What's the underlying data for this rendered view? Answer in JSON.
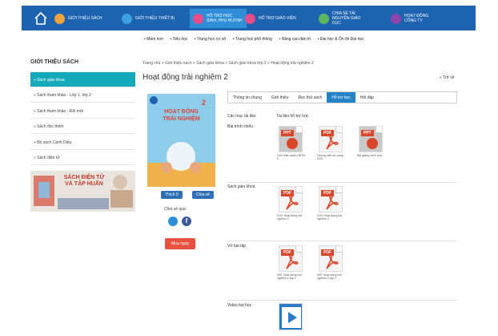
{
  "topnav": {
    "items": [
      {
        "label": "GIỚI THIỆU SÁCH",
        "icon": "book-icon",
        "color": "#f0a23b"
      },
      {
        "label": "GIỚI THIỆU THIẾT BỊ",
        "icon": "device-icon",
        "color": "#3aa0e0"
      },
      {
        "label": "HỖ TRỢ HỌC SINH, PHỤ HUYNH",
        "icon": "student-icon",
        "color": "#e94e8a"
      },
      {
        "label": "HỖ TRỢ GIÁO VIÊN",
        "icon": "teacher-icon",
        "color": "#e94e8a"
      },
      {
        "label": "CHIA SẺ TÀI NGUYÊN GIÁO DỤC",
        "icon": "share-icon",
        "color": "#5cb85c"
      },
      {
        "label": "HOẠT ĐỘNG CÔNG TY",
        "icon": "company-icon",
        "color": "#8e44ad"
      }
    ]
  },
  "subnav": {
    "items": [
      "• Mầm non",
      "• Tiểu học",
      "• Trung học cơ sở",
      "• Trung học phổ thông",
      "• Nâng cao dân trí",
      "• Đại học & Ôn thi Đại học"
    ]
  },
  "sidebar": {
    "title": "GIỚI THIỆU SÁCH",
    "items": [
      "» Sách giáo khoa",
      "» Sách tham khảo - Lớp 1, lớp 2",
      "» Sách tham khảo - Đổi mới",
      "» Sách đọc thêm",
      "» Bộ sách Cánh Diều",
      "» Sách điện tử"
    ],
    "banner": "SÁCH ĐIỆN TỬ VÀ TẬP HUẤN"
  },
  "main": {
    "breadcrumb": "Trang chủ > Giới thiệu sách > Sách giáo khoa > Sách giáo khoa lớp 2 > Hoạt động trải nghiệm 2",
    "title": "Hoạt động trải nghiệm 2",
    "back_label": "« Trở về",
    "book_cover": {
      "line1": "HOẠT ĐỘNG",
      "line2": "TRẢI NGHIỆM",
      "number": "2"
    },
    "like_label": "Thích 0",
    "share_label": "Chia sẻ",
    "share_via": "Chia sẻ qua:",
    "buy_label": "Mua ngay",
    "tabs": [
      "Thông tin chung",
      "Giới thiệu",
      "Đọc thử sách",
      "Hỗ trợ học",
      "Hỏi đáp"
    ],
    "active_tab": 3,
    "head_col1": "Các mục tài liệu",
    "head_col2": "Tài liệu hỗ trợ học",
    "sections": [
      {
        "label": "Bài trình chiếu",
        "files": [
          {
            "type": "ppt",
            "name": "Giới thiệu sách HĐTN 2"
          },
          {
            "type": "pdf",
            "name": "Hướng dẫn sử dụng SGK"
          },
          {
            "type": "ppt",
            "name": "Bài giảng minh họa"
          }
        ]
      },
      {
        "label": "Sách giáo khoa",
        "files": [
          {
            "type": "pdf",
            "name": "SGK Hoạt động trải nghiệm 2"
          },
          {
            "type": "pdf",
            "name": "SGV Hoạt động trải nghiệm 2"
          }
        ]
      },
      {
        "label": "Vở bài tập",
        "files": [
          {
            "type": "pdf",
            "name": "VBT Hoạt động trải nghiệm 2 tập 1"
          },
          {
            "type": "pdf",
            "name": "VBT Hoạt động trải nghiệm 2 tập 2"
          }
        ]
      },
      {
        "label": "Video bài học",
        "files": [
          {
            "type": "video",
            "name": ""
          }
        ]
      }
    ]
  },
  "colors": {
    "nav": "#1d63b0",
    "accent": "#14a8bb",
    "tab": "#2383c6"
  }
}
